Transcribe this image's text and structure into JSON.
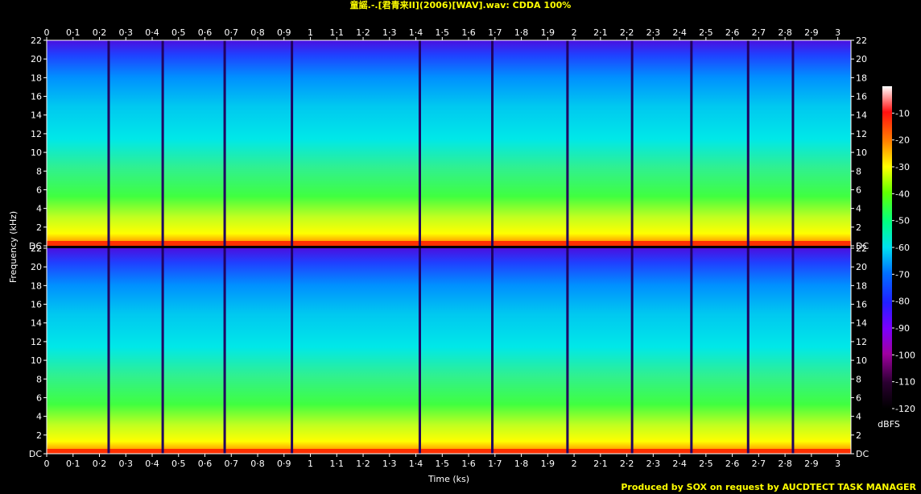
{
  "title": "童謡.-.[君青来II](2006)[WAV].wav: CDDA 100%",
  "footer": "Produced by SOX on request by AUCDTECT TASK MANAGER",
  "colors": {
    "background": "#000000",
    "title": "#ffff00",
    "text": "#ffffff"
  },
  "chart_data": {
    "type": "heatmap",
    "title": "童謡.-.[君青来II](2006)[WAV].wav: CDDA 100%",
    "xlabel": "Time (ks)",
    "ylabel": "Frequency (kHz)",
    "x_ticks": [
      "0",
      "0·1",
      "0·2",
      "0·3",
      "0·4",
      "0·5",
      "0·6",
      "0·7",
      "0·8",
      "0·9",
      "1",
      "1·1",
      "1·2",
      "1·3",
      "1·4",
      "1·5",
      "1·6",
      "1·7",
      "1·8",
      "1·9",
      "2",
      "2·1",
      "2·2",
      "2·3",
      "2·4",
      "2·5",
      "2·6",
      "2·7",
      "2·8",
      "2·9",
      "3"
    ],
    "xlim": [
      0,
      3.05
    ],
    "y_ticks": [
      "DC",
      "2",
      "4",
      "6",
      "8",
      "10",
      "12",
      "14",
      "16",
      "18",
      "20",
      "22"
    ],
    "ylim_khz": [
      0,
      22
    ],
    "channels": 2,
    "colorbar": {
      "label": "dBFS",
      "ticks": [
        "-10",
        "-20",
        "-30",
        "-40",
        "-50",
        "-60",
        "-70",
        "-80",
        "-90",
        "-100",
        "-110",
        "-120"
      ],
      "range": [
        -120,
        0
      ]
    },
    "track_boundaries_ks": [
      0.235,
      0.44,
      0.675,
      0.93,
      1.415,
      1.69,
      1.975,
      2.22,
      2.445,
      2.66,
      2.83
    ]
  }
}
